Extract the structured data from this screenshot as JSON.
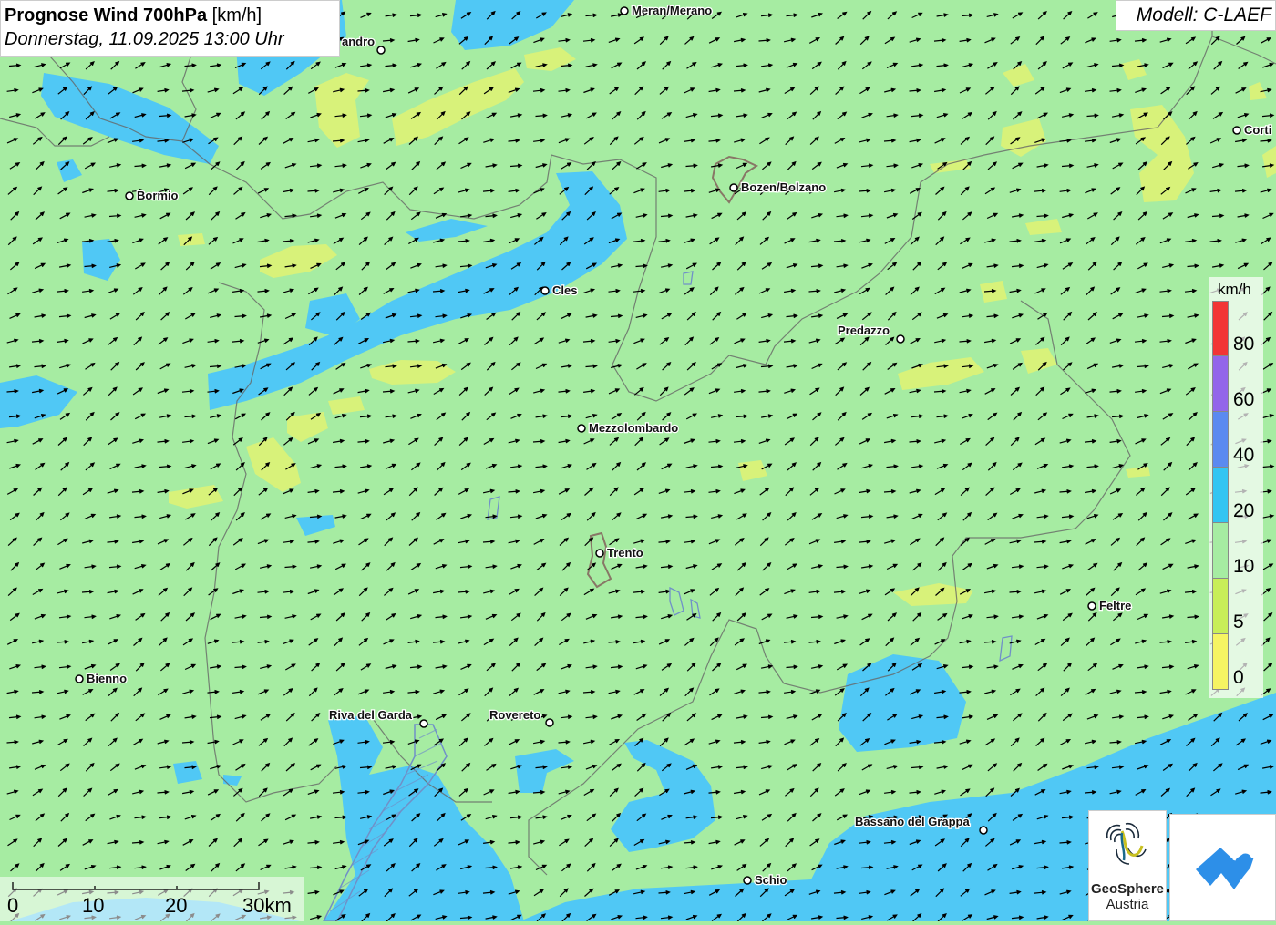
{
  "title": {
    "bold": "Prognose Wind 700hPa",
    "unit": " [km/h]",
    "datetime": "Donnerstag, 11.09.2025 13:00 Uhr"
  },
  "model": "Modell: C-LAEF",
  "legend": {
    "unit": "km/h",
    "ticks": [
      "80",
      "60",
      "40",
      "20",
      "10",
      "5",
      "0"
    ],
    "colors": [
      "#f23535",
      "#9366ea",
      "#5b8af0",
      "#33c5f2",
      "#a6eca2",
      "#c8ee58",
      "#f6f462"
    ]
  },
  "colors": {
    "wind_10_20": "#a6eca2",
    "wind_20_40": "#50c8f5",
    "wind_5_10": "#d8f27a",
    "borders": "#666666"
  },
  "cities": [
    {
      "name": "Meran/Merano"
    },
    {
      "name": "andro"
    },
    {
      "name": "Corti"
    },
    {
      "name": "Bormio"
    },
    {
      "name": "Bozen/Bolzano"
    },
    {
      "name": "Cles"
    },
    {
      "name": "Predazzo"
    },
    {
      "name": "Mezzolombardo"
    },
    {
      "name": "Trento"
    },
    {
      "name": "Feltre"
    },
    {
      "name": "Bienno"
    },
    {
      "name": "Riva del Garda"
    },
    {
      "name": "Rovereto"
    },
    {
      "name": "Bassano del Grappa"
    },
    {
      "name": "Schio"
    }
  ],
  "scale_bar": {
    "labels": [
      "0",
      "10",
      "20",
      "30km"
    ]
  },
  "logos": {
    "geosphere_name": "GeoSphere",
    "geosphere_sub": "Austria",
    "partner_icon": "cloud-arrow-icon"
  },
  "wind_arrows": {
    "direction_deg": 65,
    "icon": "wind-arrow-icon"
  }
}
